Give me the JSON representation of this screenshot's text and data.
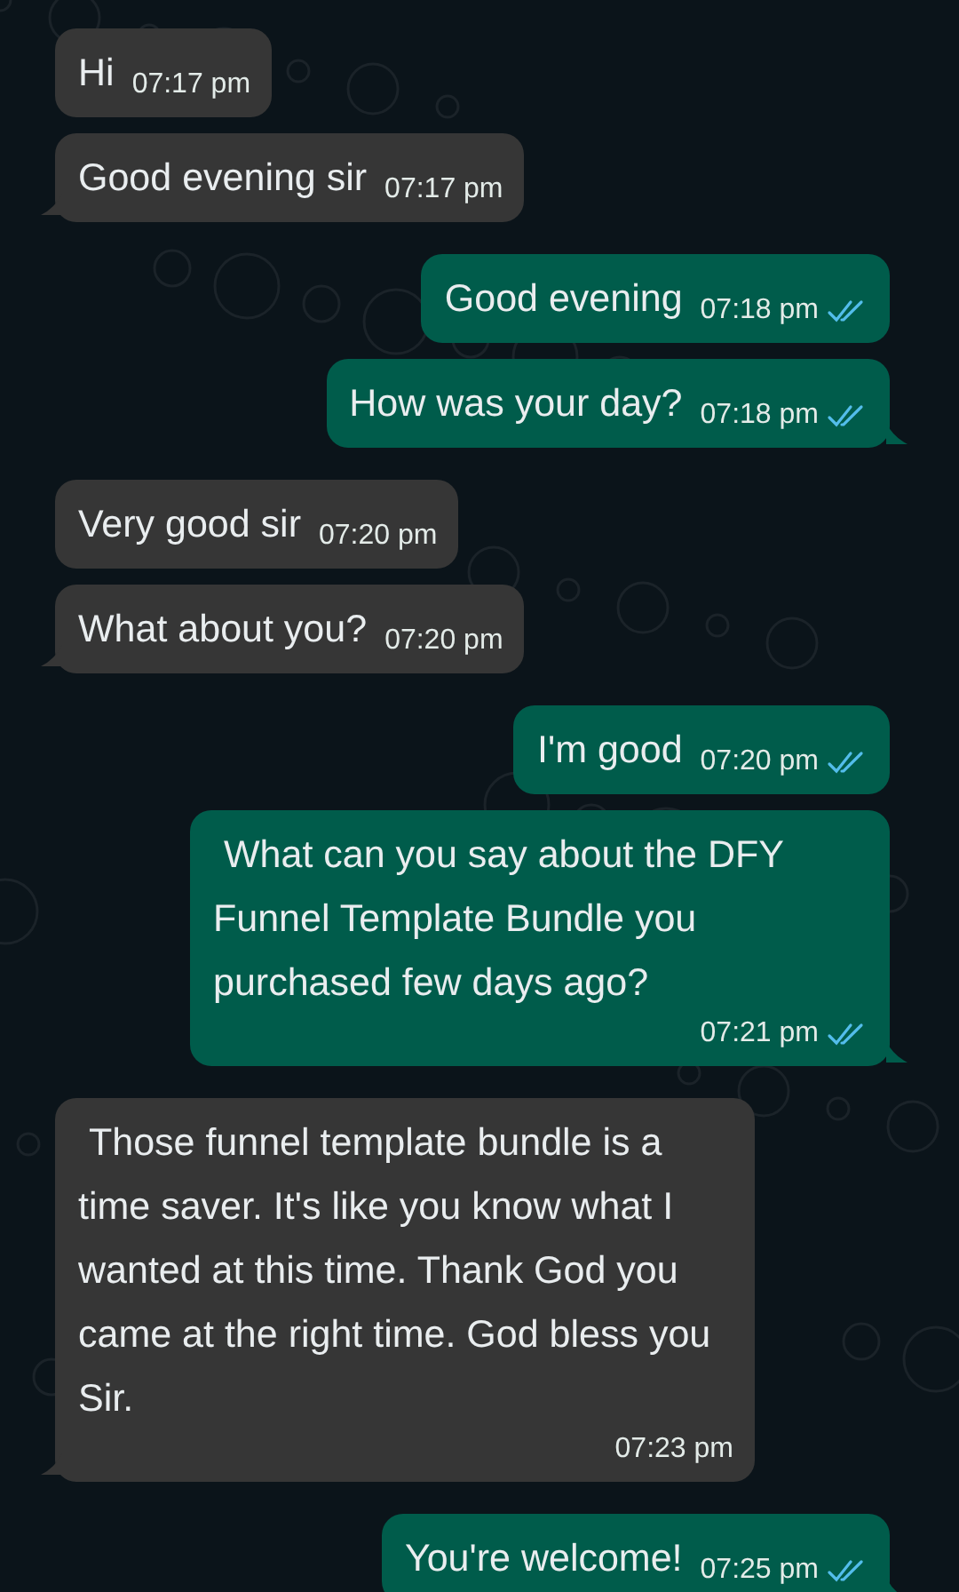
{
  "messages": [
    {
      "kind": "incoming",
      "text": "Hi",
      "time": "07:17 pm"
    },
    {
      "kind": "incoming",
      "text": "Good evening sir",
      "time": "07:17 pm"
    },
    {
      "kind": "outgoing",
      "text": "Good evening",
      "time": "07:18 pm",
      "read": true
    },
    {
      "kind": "outgoing",
      "text": "How was your day?",
      "time": "07:18 pm",
      "read": true
    },
    {
      "kind": "incoming",
      "text": "Very good sir",
      "time": "07:20 pm"
    },
    {
      "kind": "incoming",
      "text": "What about you?",
      "time": "07:20 pm"
    },
    {
      "kind": "outgoing",
      "text": "I'm good",
      "time": "07:20 pm",
      "read": true
    },
    {
      "kind": "outgoing",
      "text": " What can you say about the DFY Funnel Template Bundle you purchased few days ago?",
      "time": "07:21 pm",
      "read": true
    },
    {
      "kind": "incoming",
      "text": " Those funnel template bundle is a time saver. It's like you know what I wanted at this time. Thank God you came at the right time. God bless you Sir.",
      "time": "07:23 pm"
    },
    {
      "kind": "outgoing",
      "text": "You're welcome!",
      "time": "07:25 pm",
      "read": true
    }
  ]
}
